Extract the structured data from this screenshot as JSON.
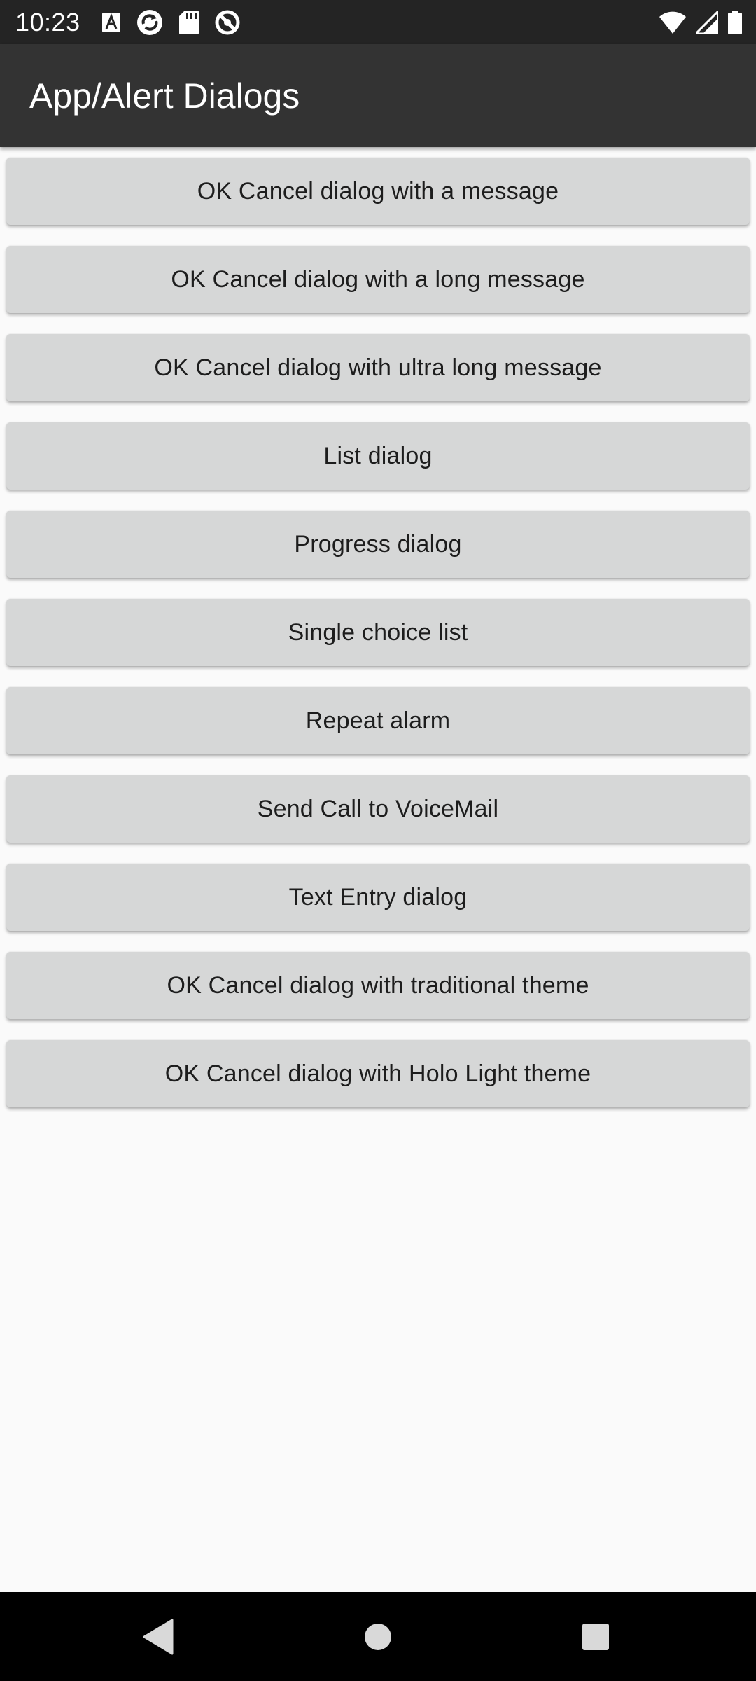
{
  "status_bar": {
    "time": "10:23",
    "left_icons": [
      "text-a-icon",
      "sync-icon",
      "sd-card-icon",
      "do-not-disturb-icon"
    ],
    "right_icons": [
      "wifi-icon",
      "signal-icon",
      "battery-icon"
    ]
  },
  "app_bar": {
    "title": "App/Alert Dialogs"
  },
  "buttons": [
    {
      "label": "OK Cancel dialog with a message"
    },
    {
      "label": "OK Cancel dialog with a long message"
    },
    {
      "label": "OK Cancel dialog with ultra long message"
    },
    {
      "label": "List dialog"
    },
    {
      "label": "Progress dialog"
    },
    {
      "label": "Single choice list"
    },
    {
      "label": "Repeat alarm"
    },
    {
      "label": "Send Call to VoiceMail"
    },
    {
      "label": "Text Entry dialog"
    },
    {
      "label": "OK Cancel dialog with traditional theme"
    },
    {
      "label": "OK Cancel dialog with Holo Light theme"
    }
  ],
  "nav_bar": {
    "icons": [
      "back-icon",
      "home-icon",
      "recents-icon"
    ]
  },
  "colors": {
    "status_bar": "#242424",
    "app_bar": "#333333",
    "background": "#fafafa",
    "button": "#d6d7d7",
    "nav_bar": "#000000"
  }
}
